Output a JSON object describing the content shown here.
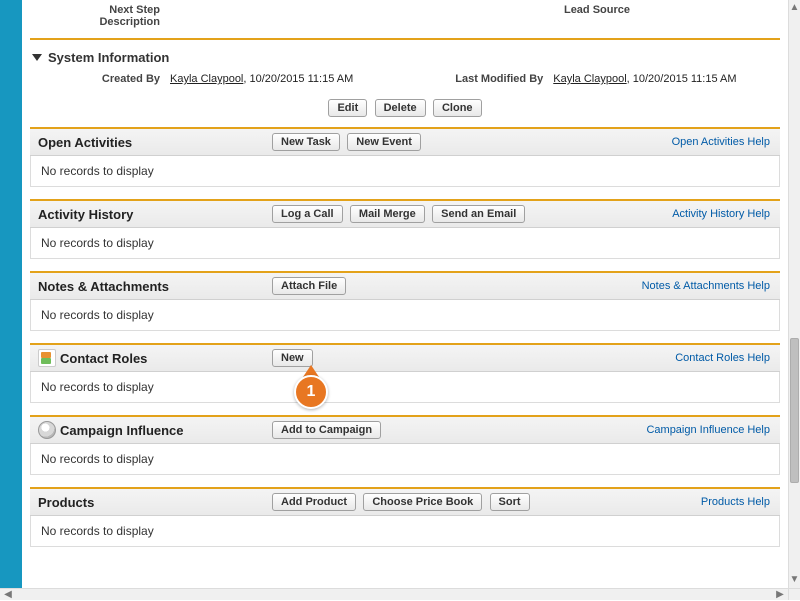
{
  "top_fields": {
    "next_step_label": "Next Step",
    "lead_source_label": "Lead Source",
    "description_label": "Description"
  },
  "system_info": {
    "heading": "System Information",
    "created_by_label": "Created By",
    "created_by_name": "Kayla Claypool",
    "created_by_ts": ", 10/20/2015 11:15 AM",
    "modified_by_label": "Last Modified By",
    "modified_by_name": "Kayla Claypool",
    "modified_by_ts": ", 10/20/2015 11:15 AM"
  },
  "record_actions": {
    "edit": "Edit",
    "delete": "Delete",
    "clone": "Clone"
  },
  "sections": {
    "open_activities": {
      "title": "Open Activities",
      "buttons": [
        "New Task",
        "New Event"
      ],
      "help": "Open Activities Help",
      "empty": "No records to display"
    },
    "activity_history": {
      "title": "Activity History",
      "buttons": [
        "Log a Call",
        "Mail Merge",
        "Send an Email"
      ],
      "help": "Activity History Help",
      "empty": "No records to display"
    },
    "notes_attachments": {
      "title": "Notes & Attachments",
      "buttons": [
        "Attach File"
      ],
      "help": "Notes & Attachments Help",
      "empty": "No records to display"
    },
    "contact_roles": {
      "title": "Contact Roles",
      "buttons": [
        "New"
      ],
      "help": "Contact Roles Help",
      "empty": "No records to display"
    },
    "campaign_influence": {
      "title": "Campaign Influence",
      "buttons": [
        "Add to Campaign"
      ],
      "help": "Campaign Influence Help",
      "empty": "No records to display"
    },
    "products": {
      "title": "Products",
      "buttons": [
        "Add Product",
        "Choose Price Book",
        "Sort"
      ],
      "help": "Products Help",
      "empty": "No records to display"
    }
  },
  "callout": {
    "number": "1"
  }
}
